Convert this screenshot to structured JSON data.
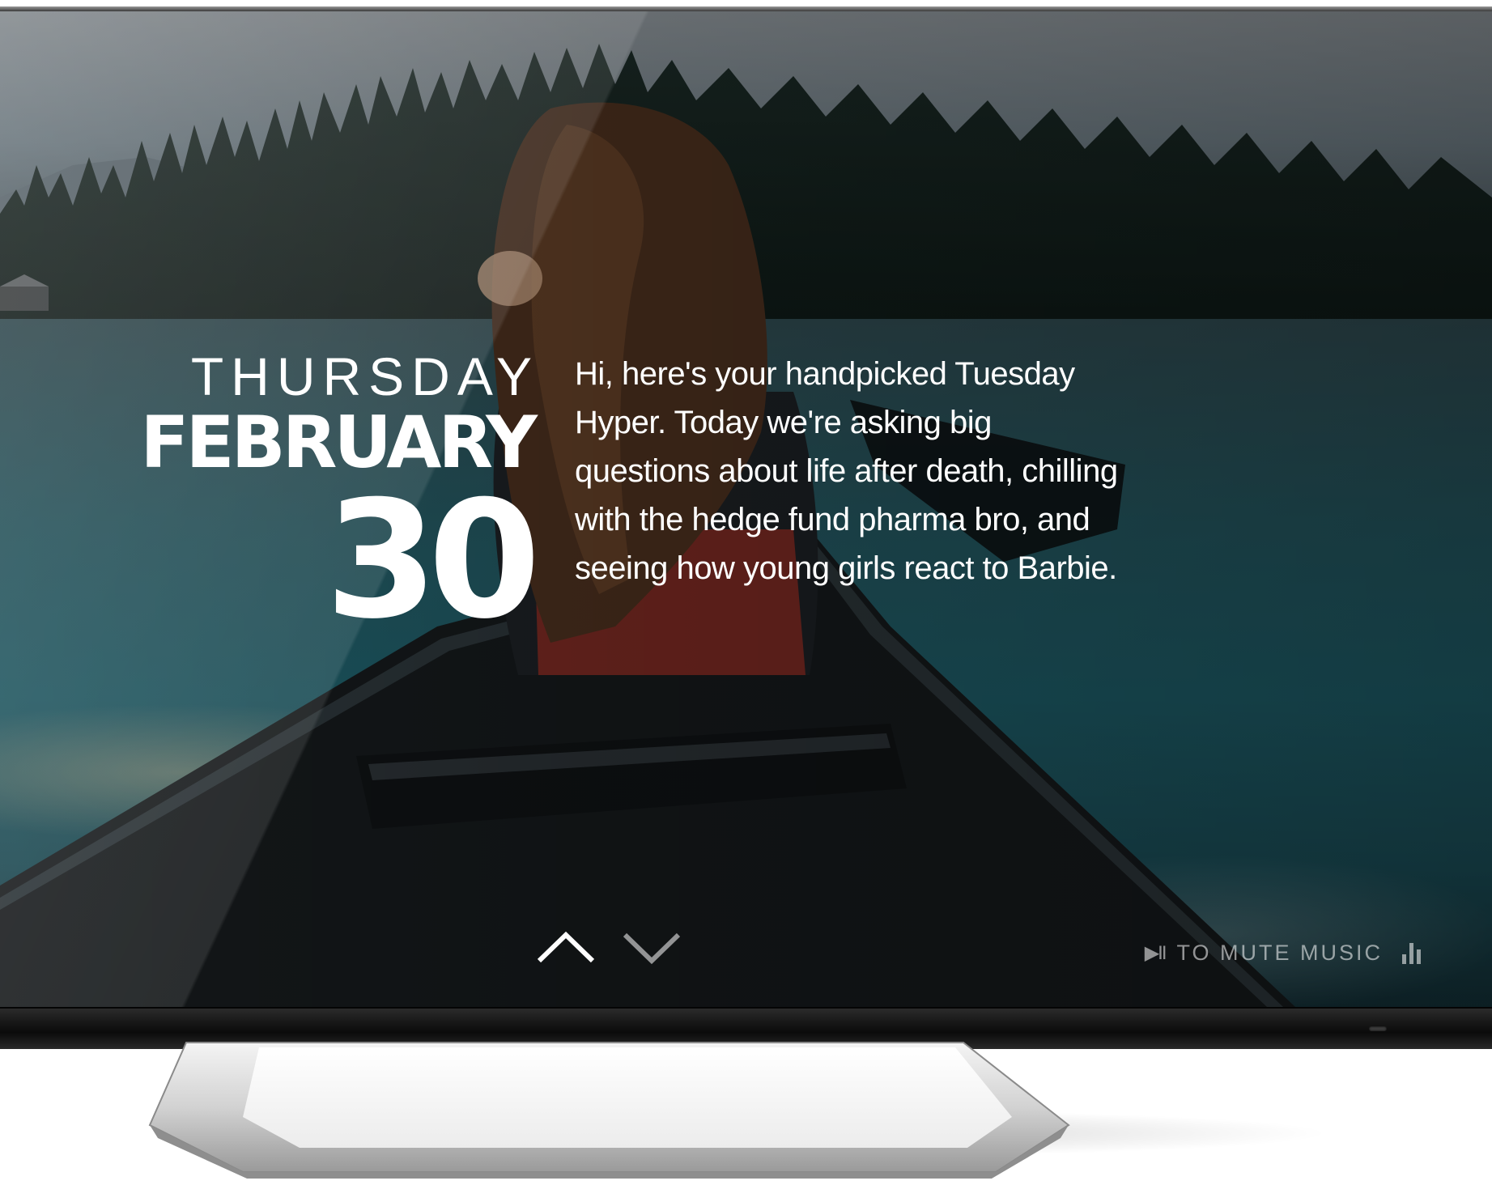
{
  "date": {
    "weekday": "THURSDAY",
    "month": "FEBRUARY",
    "day": "30"
  },
  "greeting": {
    "text": "Hi, here's your handpicked Tuesday Hyper. Today we're asking big questions about life after death, chilling with the hedge fund pharma bro, and seeing how young girls react to Barbie."
  },
  "navigation": {
    "up_icon": "chevron-up-icon",
    "down_icon": "chevron-down-icon"
  },
  "audio": {
    "play_pause_glyph": "▶II",
    "mute_hint": "TO MUTE MUSIC",
    "equalizer_icon": "equalizer-icon"
  },
  "colors": {
    "text": "#ffffff",
    "hint_text": "rgba(255,255,255,0.55)",
    "water": "#1d5b66",
    "bezel": "#111111"
  }
}
